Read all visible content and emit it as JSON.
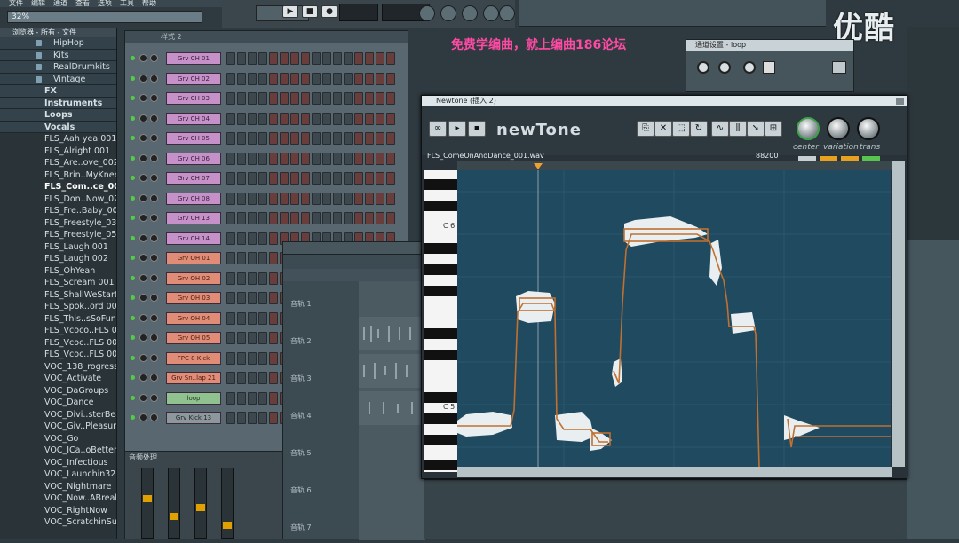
{
  "menu": {
    "items": [
      "文件",
      "编辑",
      "通道",
      "查看",
      "选项",
      "工具",
      "帮助"
    ]
  },
  "zoom_readout": "32%",
  "watermark_logo": "优酷",
  "promo_text": "免费学编曲，就上编曲186论坛",
  "browser": {
    "header": "浏览器 - 所有 - 文件",
    "folders_top": [
      "HipHop",
      "Kits",
      "RealDrumkits",
      "Vintage"
    ],
    "folders_main": [
      "FX",
      "Instruments",
      "Loops",
      "Vocals"
    ],
    "files": [
      {
        "label": "FLS_Aah yea 001",
        "selected": false
      },
      {
        "label": "FLS_Alright 001",
        "selected": false
      },
      {
        "label": "FLS_Are..ove_002",
        "selected": false
      },
      {
        "label": "FLS_Brin..MyKnees",
        "selected": false
      },
      {
        "label": "FLS_Com..ce_001",
        "selected": true
      },
      {
        "label": "FLS_Don..Now_02",
        "selected": false
      },
      {
        "label": "FLS_Fre..Baby_003",
        "selected": false
      },
      {
        "label": "FLS_Freestyle_03",
        "selected": false
      },
      {
        "label": "FLS_Freestyle_05",
        "selected": false
      },
      {
        "label": "FLS_Laugh 001",
        "selected": false
      },
      {
        "label": "FLS_Laugh 002",
        "selected": false
      },
      {
        "label": "FLS_OhYeah",
        "selected": false
      },
      {
        "label": "FLS_Scream 001",
        "selected": false
      },
      {
        "label": "FLS_ShallWeStart",
        "selected": false
      },
      {
        "label": "FLS_Spok..ord 001",
        "selected": false
      },
      {
        "label": "FLS_This..sSoFunky",
        "selected": false
      },
      {
        "label": "FLS_Vcoco..FLS 001",
        "selected": false
      },
      {
        "label": "FLS_Vcoc..FLS 002",
        "selected": false
      },
      {
        "label": "FLS_Vcoc..FLS 003",
        "selected": false
      },
      {
        "label": "VOC_138_rogress",
        "selected": false
      },
      {
        "label": "VOC_Activate",
        "selected": false
      },
      {
        "label": "VOC_DaGroups",
        "selected": false
      },
      {
        "label": "VOC_Dance",
        "selected": false
      },
      {
        "label": "VOC_Divi..sterBeat",
        "selected": false
      },
      {
        "label": "VOC_Giv..Pleasure",
        "selected": false
      },
      {
        "label": "VOC_Go",
        "selected": false
      },
      {
        "label": "VOC_ICa..oBetter",
        "selected": false
      },
      {
        "label": "VOC_Infectious",
        "selected": false
      },
      {
        "label": "VOC_Launchin321",
        "selected": false
      },
      {
        "label": "VOC_Nightmare",
        "selected": false
      },
      {
        "label": "VOC_Now..ABreak",
        "selected": false
      },
      {
        "label": "VOC_RightNow",
        "selected": false
      },
      {
        "label": "VOC_ScratchinSurf",
        "selected": false
      }
    ]
  },
  "channel_rack": {
    "header": "样式 2",
    "channels": [
      {
        "label": "Grv CH 01",
        "color": "purple"
      },
      {
        "label": "Grv CH 02",
        "color": "purple"
      },
      {
        "label": "Grv CH 03",
        "color": "purple"
      },
      {
        "label": "Grv CH 04",
        "color": "purple"
      },
      {
        "label": "Grv CH 05",
        "color": "purple"
      },
      {
        "label": "Grv CH 06",
        "color": "purple"
      },
      {
        "label": "Grv CH 07",
        "color": "purple"
      },
      {
        "label": "Grv CH 08",
        "color": "purple"
      },
      {
        "label": "Grv CH 13",
        "color": "purple"
      },
      {
        "label": "Grv CH 14",
        "color": "purple"
      },
      {
        "label": "Grv OH 01",
        "color": "orange"
      },
      {
        "label": "Grv OH 02",
        "color": "orange"
      },
      {
        "label": "Grv OH 03",
        "color": "orange"
      },
      {
        "label": "Grv OH 04",
        "color": "orange"
      },
      {
        "label": "Grv OH 05",
        "color": "orange"
      },
      {
        "label": "FPC 8 Kick",
        "color": "orange"
      },
      {
        "label": "Grv Sn..lap 21",
        "color": "orange"
      },
      {
        "label": "loop",
        "color": "green"
      },
      {
        "label": "Grv Kick 13",
        "color": "gray"
      }
    ],
    "mixer_label": "音频处理"
  },
  "playlist": {
    "tracks": [
      "音轨 1",
      "音轨 2",
      "音轨 3",
      "音轨 4",
      "音轨 5",
      "音轨 6",
      "音轨 7"
    ]
  },
  "fx_panel": {
    "title": "通道设置 - loop"
  },
  "newtone": {
    "window_title": "Newtone (插入 2)",
    "logo": "newTone",
    "file_name": "FLS_ComeOnAndDance_001.wav",
    "sample_rate": "88200",
    "knobs": [
      "center",
      "variation",
      "trans"
    ],
    "key_labels": [
      "C 6",
      "C 5"
    ],
    "accent_color": "#f0a030",
    "pitch_line_color": "#c07030"
  }
}
